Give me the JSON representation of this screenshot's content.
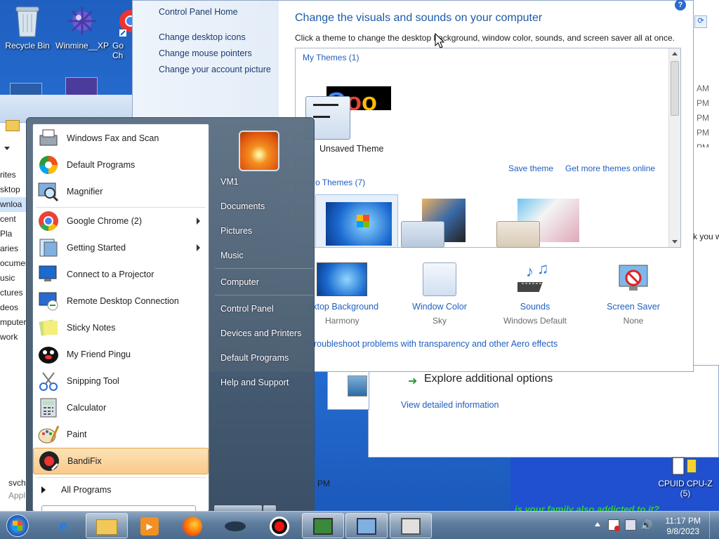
{
  "desktop": {
    "icons": [
      {
        "label": "Recycle Bin",
        "icon": "recycle-bin-icon"
      },
      {
        "label": "Winmine__XP",
        "icon": "mine-icon"
      },
      {
        "label": "Go",
        "label2": "Ch",
        "icon": "chrome-shortcut-icon"
      }
    ],
    "cpuz": {
      "label": "CPUID CPU-Z",
      "count": "(5)"
    },
    "banner_text": "is your family also addicted to it?"
  },
  "explorer": {
    "nav": [
      "rites",
      "sktop",
      "wnloa",
      "cent Pla",
      "",
      "aries",
      "ocumen",
      "usic",
      "ctures",
      "deos",
      "",
      "mputer",
      "",
      "work"
    ],
    "bottom_name": "svch",
    "bottom_sub": "Appl"
  },
  "control_panel": {
    "side_links": [
      "Control Panel Home",
      "Change desktop icons",
      "Change mouse pointers",
      "Change your account picture"
    ],
    "title": "Change the visuals and sounds on your computer",
    "subtitle": "Click a theme to change the desktop background, window color, sounds, and screen saver all at once.",
    "my_themes": "My Themes (1)",
    "unsaved_theme": "Unsaved Theme",
    "save_theme": "Save theme",
    "get_more": "Get more themes online",
    "aero_themes": "o Themes (7)",
    "bottom": [
      {
        "label": "sktop Background",
        "value": "Harmony"
      },
      {
        "label": "Window Color",
        "value": "Sky"
      },
      {
        "label": "Sounds",
        "value": "Windows Default"
      },
      {
        "label": "Screen Saver",
        "value": "None"
      }
    ],
    "troubleshoot": "roubleshoot problems with transparency and other Aero effects"
  },
  "right_window": {
    "times": [
      "AM",
      "PM",
      "PM",
      "PM",
      "PM"
    ],
    "fragment": "k you w",
    "explore": "Explore additional options",
    "view_detail": "View detailed information",
    "pm": "PM"
  },
  "start_menu": {
    "user": "VM1",
    "programs": [
      {
        "label": "Windows Fax and Scan",
        "icon": "fax-icon",
        "arrow": false
      },
      {
        "label": "Default Programs",
        "icon": "default-programs-icon",
        "arrow": false
      },
      {
        "label": "Magnifier",
        "icon": "magnifier-icon",
        "arrow": false
      },
      {
        "label": "Google Chrome (2)",
        "icon": "chrome-icon",
        "arrow": true
      },
      {
        "label": "Getting Started",
        "icon": "getting-started-icon",
        "arrow": true
      },
      {
        "label": "Connect to a Projector",
        "icon": "projector-icon",
        "arrow": false
      },
      {
        "label": "Remote Desktop Connection",
        "icon": "remote-desktop-icon",
        "arrow": false
      },
      {
        "label": "Sticky Notes",
        "icon": "sticky-notes-icon",
        "arrow": false
      },
      {
        "label": "My Friend Pingu",
        "icon": "pingu-icon",
        "arrow": false
      },
      {
        "label": "Snipping Tool",
        "icon": "scissors-icon",
        "arrow": false
      },
      {
        "label": "Calculator",
        "icon": "calculator-icon",
        "arrow": false
      },
      {
        "label": "Paint",
        "icon": "paint-icon",
        "arrow": false
      },
      {
        "label": "BandiFix",
        "icon": "bandifix-icon",
        "arrow": false
      }
    ],
    "all_programs": "All Programs",
    "right_links": [
      "Documents",
      "Pictures",
      "Music",
      "Computer",
      "Control Panel",
      "Devices and Printers",
      "Default Programs",
      "Help and Support"
    ]
  },
  "taskbar": {
    "time": "11:17 PM",
    "date": "9/8/2023"
  }
}
